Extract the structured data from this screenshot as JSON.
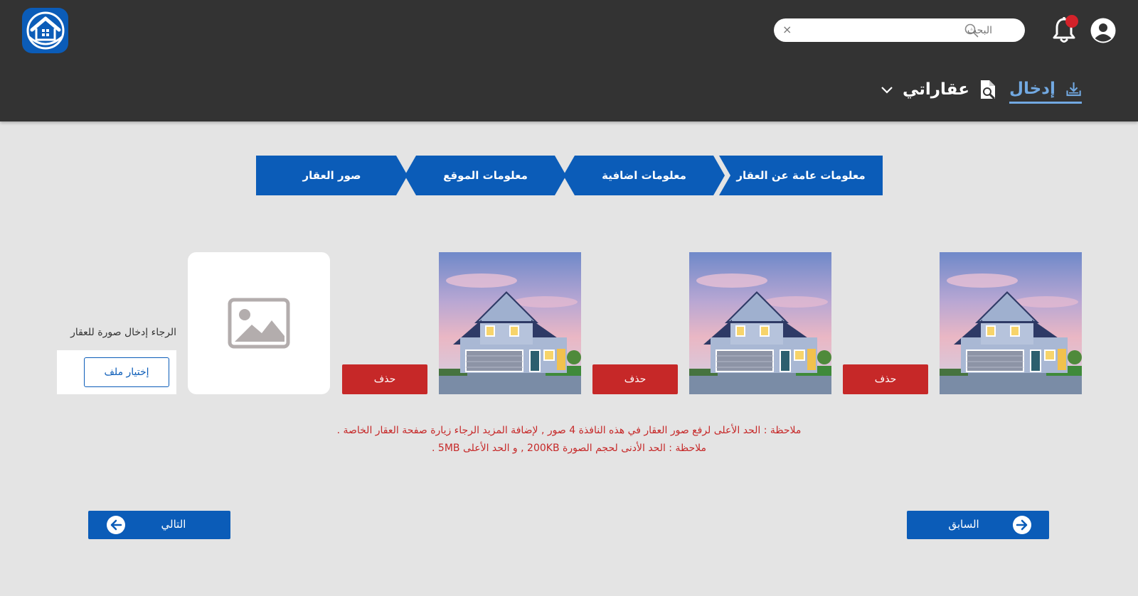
{
  "header": {
    "search_placeholder": "البحث",
    "clear_symbol": "×",
    "nav_insert_label": "إدخال",
    "nav_mine_label": "عقاراتي"
  },
  "steps": [
    {
      "label": "معلومات عامة عن العقار"
    },
    {
      "label": "معلومات اضافية"
    },
    {
      "label": "معلومات الموقع"
    },
    {
      "label": "صور العقار"
    }
  ],
  "photos": {
    "delete_label": "حذف",
    "count": 3
  },
  "upload": {
    "prompt": "الرجاء إدخال صورة للعقار",
    "choose_file_label": "إختيار ملف"
  },
  "notes": {
    "line1": "ملاحظة : الحد الأعلى لرفع صور العقار في هذه النافذة 4 صور , لإضافة المزيد الرجاء زيارة صفحة العقار الخاصة .",
    "line2": "ملاحظة : الحد الأدنى لحجم الصورة 200KB , و الحد الأعلى 5MB ."
  },
  "footer": {
    "previous_label": "السابق",
    "next_label": "التالي"
  },
  "colors": {
    "header_bg": "#333333",
    "primary": "#0b5cb8",
    "active_nav": "#72a9e2",
    "danger": "#c62828",
    "page_bg": "#e4e4e4"
  }
}
